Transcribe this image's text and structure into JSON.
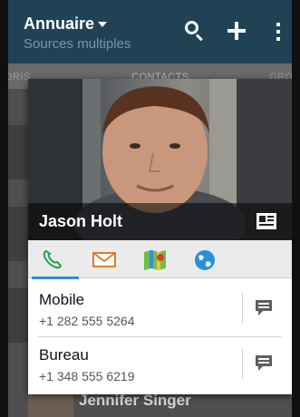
{
  "app": {
    "title": "Annuaire",
    "subtitle": "Sources multiples"
  },
  "tabs": [
    {
      "label": "ORIS"
    },
    {
      "label": "CONTACTS"
    },
    {
      "label": "GROU"
    }
  ],
  "background_list": {
    "visible_name": "Jennifer Singer"
  },
  "contact": {
    "name": "Jason Holt"
  },
  "actions": {
    "items": [
      {
        "icon": "phone-icon",
        "active": true
      },
      {
        "icon": "mail-icon",
        "active": false
      },
      {
        "icon": "map-icon",
        "active": false
      },
      {
        "icon": "globe-icon",
        "active": false
      }
    ]
  },
  "numbers": [
    {
      "label": "Mobile",
      "value": "+1 282 555 5264"
    },
    {
      "label": "Bureau",
      "value": "+1 348 555 6219"
    }
  ],
  "colors": {
    "appbar": "#1f4255",
    "accent": "#2f8fd4"
  }
}
